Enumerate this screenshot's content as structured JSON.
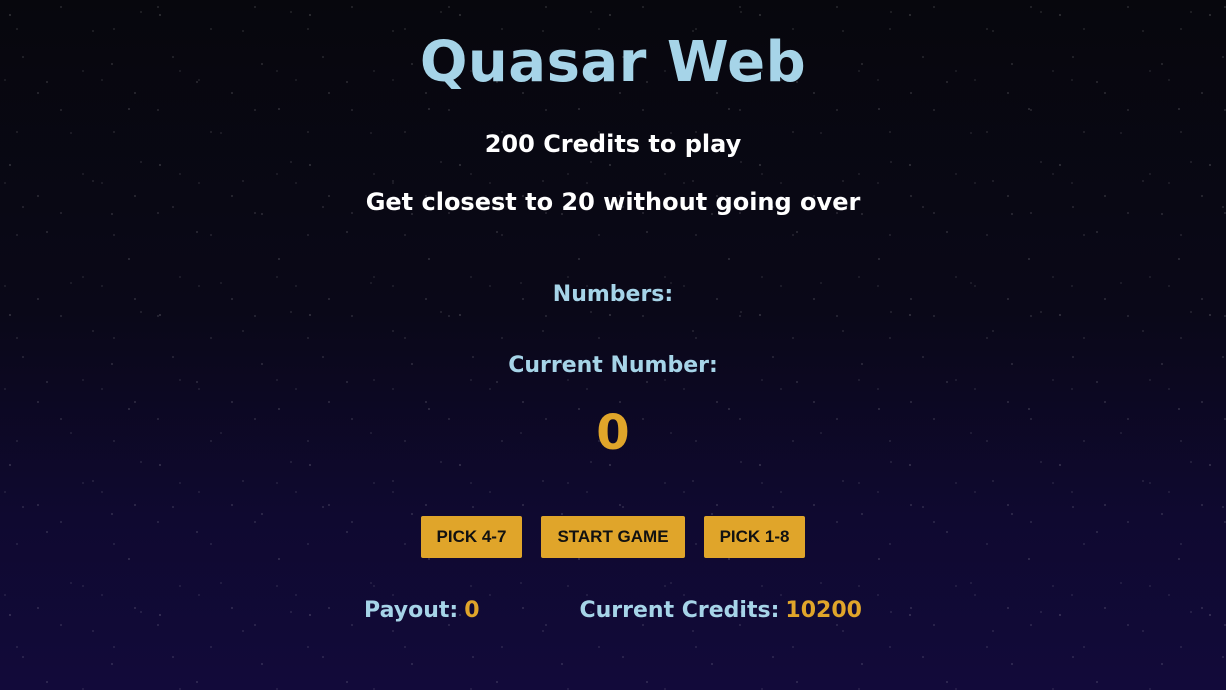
{
  "header": {
    "title": "Quasar Web",
    "cost_text": "200 Credits to play",
    "goal_text": "Get closest to 20 without going over"
  },
  "game": {
    "numbers_label": "Numbers:",
    "current_number_label": "Current Number:",
    "current_number_value": "0"
  },
  "buttons": {
    "pick_low": "PICK 4-7",
    "start": "START GAME",
    "pick_wide": "PICK 1-8"
  },
  "stats": {
    "payout_label": "Payout:",
    "payout_value": "0",
    "credits_label": "Current Credits:",
    "credits_value": "10200"
  },
  "colors": {
    "title": "#a6d4e8",
    "accent": "#e0a52a",
    "text": "#ffffff",
    "background": "#0a0818"
  }
}
